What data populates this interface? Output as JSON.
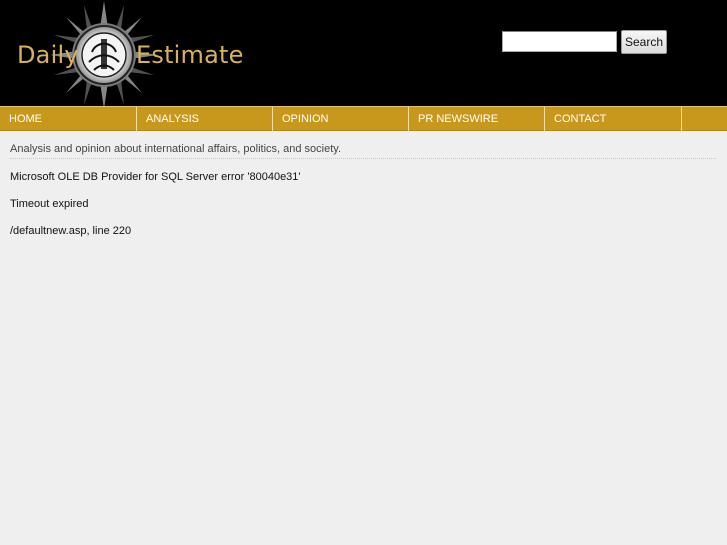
{
  "header": {
    "logo_left": "Daily",
    "logo_right": "Estimate"
  },
  "search": {
    "placeholder": "",
    "button_label": "Search"
  },
  "nav": [
    {
      "label": "HOME"
    },
    {
      "label": "ANALYSIS"
    },
    {
      "label": "OPINION"
    },
    {
      "label": "PR NEWSWIRE"
    },
    {
      "label": "CONTACT"
    }
  ],
  "tagline": "Analysis and opinion about international affairs, politics, and society.",
  "errors": [
    "Microsoft OLE DB Provider for SQL Server error '80040e31'",
    "Timeout expired",
    "/defaultnew.asp, line 220"
  ],
  "colors": {
    "page_background": "#efefef",
    "header_background": "#000000",
    "nav_background": "#c7981c",
    "logo_text": "#d8b25a"
  }
}
